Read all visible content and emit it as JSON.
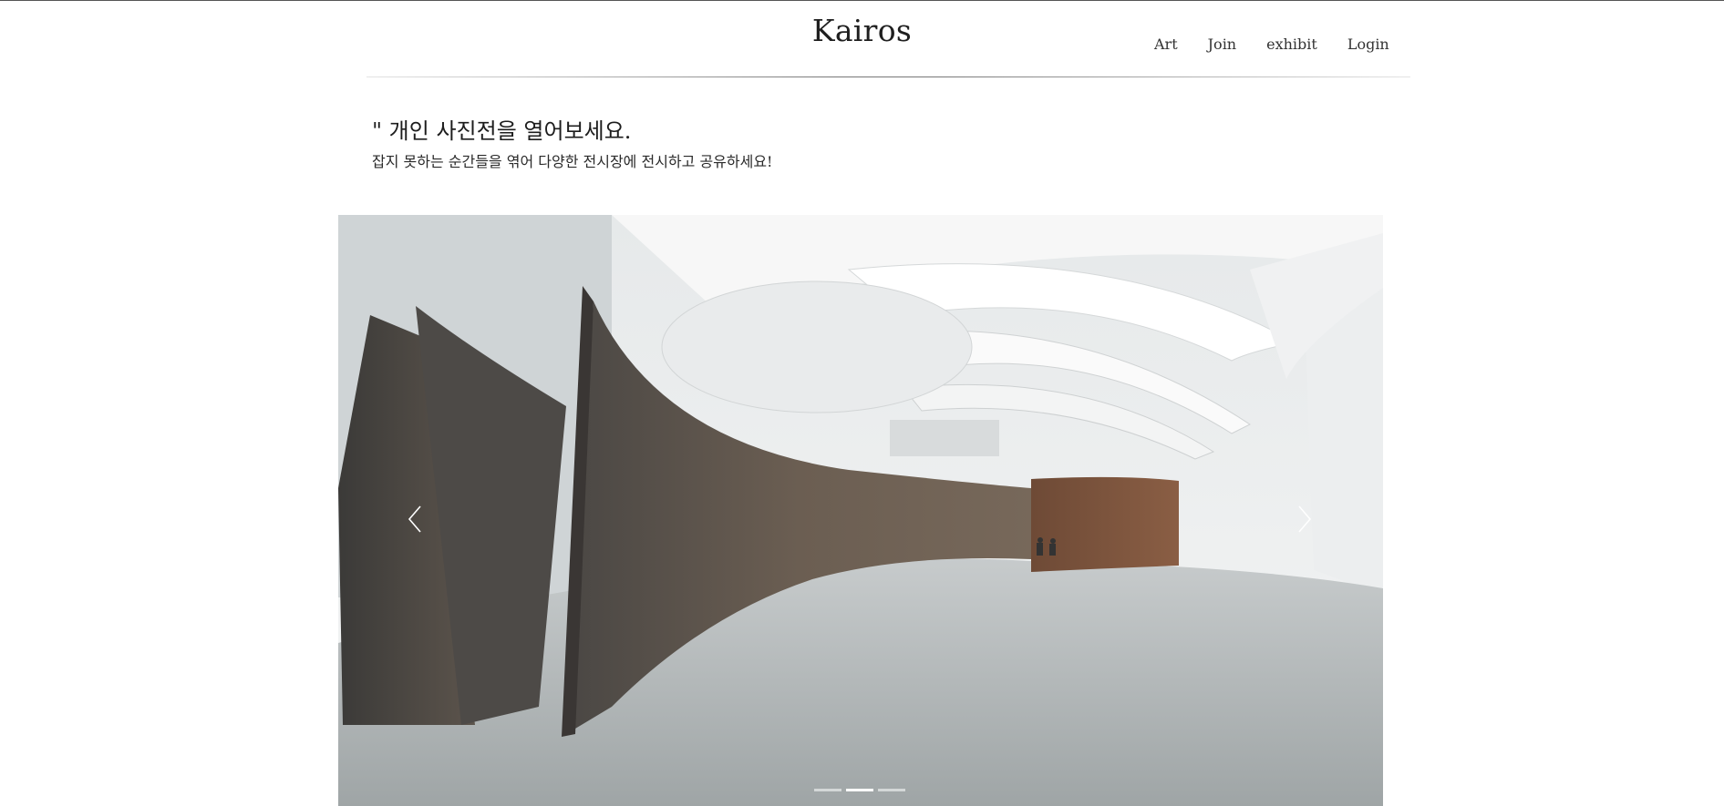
{
  "header": {
    "brand": "Kairos",
    "nav": [
      {
        "label": "Art"
      },
      {
        "label": "Join"
      },
      {
        "label": "exhibit"
      },
      {
        "label": "Login"
      }
    ]
  },
  "intro": {
    "headline": "\" 개인 사진전을 열어보세요.",
    "subline": "잡지 못하는 순간들을 엮어 다양한 전시장에 전시하고 공유하세요!"
  },
  "carousel": {
    "slide_count": 3,
    "active_index": 1,
    "image_subject": "museum interior with curved steel sculptures"
  },
  "colors": {
    "text": "#222222",
    "rule": "#777777",
    "steel": "#5a5048"
  }
}
